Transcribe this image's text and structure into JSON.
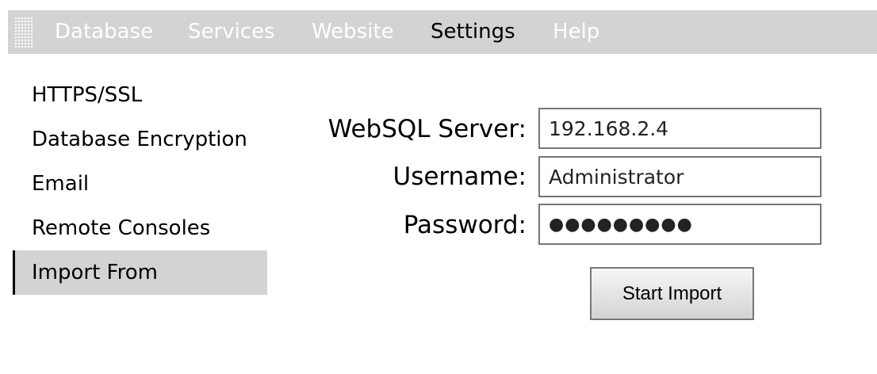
{
  "menubar": {
    "items": [
      {
        "label": "Database",
        "active": false
      },
      {
        "label": "Services",
        "active": false
      },
      {
        "label": "Website",
        "active": false
      },
      {
        "label": "Settings",
        "active": true
      },
      {
        "label": "Help",
        "active": false
      }
    ]
  },
  "sidebar": {
    "items": [
      {
        "label": "HTTPS/SSL",
        "selected": false
      },
      {
        "label": "Database Encryption",
        "selected": false
      },
      {
        "label": "Email",
        "selected": false
      },
      {
        "label": "Remote Consoles",
        "selected": false
      },
      {
        "label": "Import From",
        "selected": true
      }
    ]
  },
  "form": {
    "server_label": "WebSQL Server:",
    "server_value": "192.168.2.4",
    "username_label": "Username:",
    "username_value": "Administrator",
    "password_label": "Password:",
    "password_value": "●●●●●●●●●",
    "start_button": "Start Import"
  },
  "colors": {
    "menubar_background": "#d3d3d3",
    "menu_text_inactive": "#ffffff",
    "menu_text_active": "#000000",
    "selected_item_background": "#d3d3d3",
    "input_border": "#777777"
  }
}
